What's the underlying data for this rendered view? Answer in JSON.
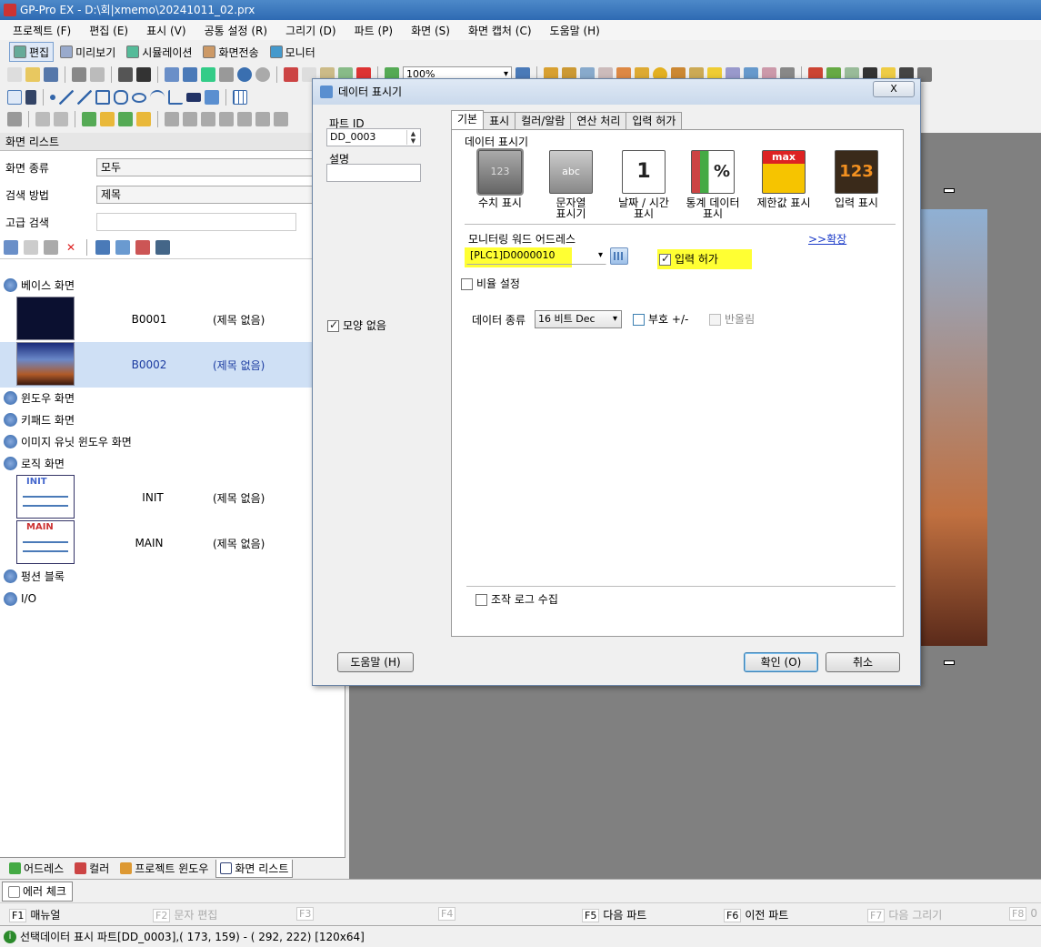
{
  "window": {
    "title": "GP-Pro EX - D:\\회|xmemo\\20241011_02.prx"
  },
  "menu": [
    "프로젝트 (F)",
    "편집 (E)",
    "표시 (V)",
    "공통 설정 (R)",
    "그리기 (D)",
    "파트 (P)",
    "화면 (S)",
    "화면 캡처 (C)",
    "도움말 (H)"
  ],
  "modes": [
    "편집",
    "미리보기",
    "시뮬레이션",
    "화면전송",
    "모니터"
  ],
  "toolbar": {
    "zoom": "100%"
  },
  "screen_list": {
    "title": "화면 리스트",
    "filter_type_label": "화면 종류",
    "filter_type_value": "모두",
    "search_method_label": "검색 방법",
    "search_method_value": "제목",
    "advanced_search_label": "고급 검색",
    "tree": {
      "base": "베이스 화면",
      "window": "윈도우 화면",
      "keypad": "키패드 화면",
      "image_unit": "이미지 유닛 윈도우 화면",
      "logic": "로직 화면",
      "function_block": "펑션 블록",
      "io": "I/O"
    },
    "base_items": [
      {
        "code": "B0001",
        "title": "(제목 없음)"
      },
      {
        "code": "B0002",
        "title": "(제목 없음)"
      }
    ],
    "logic_items": [
      {
        "code": "INIT",
        "title": "(제목 없음)",
        "label": "INIT"
      },
      {
        "code": "MAIN",
        "title": "(제목 없음)",
        "label": "MAIN"
      }
    ]
  },
  "bottom_tabs": [
    "어드레스",
    "컬러",
    "프로젝트 윈도우",
    "화면 리스트"
  ],
  "error_tab": "에러 체크",
  "fkeys": [
    {
      "key": "F1",
      "label": "매뉴얼"
    },
    {
      "key": "F2",
      "label": "문자 편집"
    },
    {
      "key": "F3",
      "label": ""
    },
    {
      "key": "F4",
      "label": ""
    },
    {
      "key": "F5",
      "label": "다음 파트"
    },
    {
      "key": "F6",
      "label": "이전 파트"
    },
    {
      "key": "F7",
      "label": "다음 그리기"
    },
    {
      "key": "F8",
      "label": "0"
    }
  ],
  "status": "선택데이터 표시 파트[DD_0003],( 173, 159) - ( 292, 222) [120x64]",
  "dialog": {
    "title": "데이터 표시기",
    "close": "X",
    "part_id_label": "파트 ID",
    "part_id": "DD_0003",
    "desc_label": "설명",
    "no_shape": "모양 없음",
    "tabs": [
      "기본",
      "표시",
      "컬러/알람",
      "연산 처리",
      "입력 허가"
    ],
    "group_label": "데이터 표시기",
    "types": [
      {
        "label": "수치 표시",
        "icon_text": "123"
      },
      {
        "label": "문자열\n표시기",
        "icon_text": "abc"
      },
      {
        "label": "날짜 / 시간\n표시",
        "icon_text": "1"
      },
      {
        "label": "통계 데이터\n표시",
        "icon_text": "%"
      },
      {
        "label": "제한값 표시",
        "icon_text": "max"
      },
      {
        "label": "입력 표시",
        "icon_text": "123"
      }
    ],
    "monitor_label": "모니터링 워드 어드레스",
    "monitor_address": "[PLC1]D0000010",
    "expand": ">>확장",
    "input_permit": "입력 허가",
    "ratio": "비율 설정",
    "data_type_label": "데이터 종류",
    "data_type": "16 비트 Dec",
    "sign": "부호 +/-",
    "round": "반올림",
    "op_log": "조작 로그 수집",
    "help_btn": "도움말 (H)",
    "ok_btn": "확인 (O)",
    "cancel_btn": "취소"
  }
}
